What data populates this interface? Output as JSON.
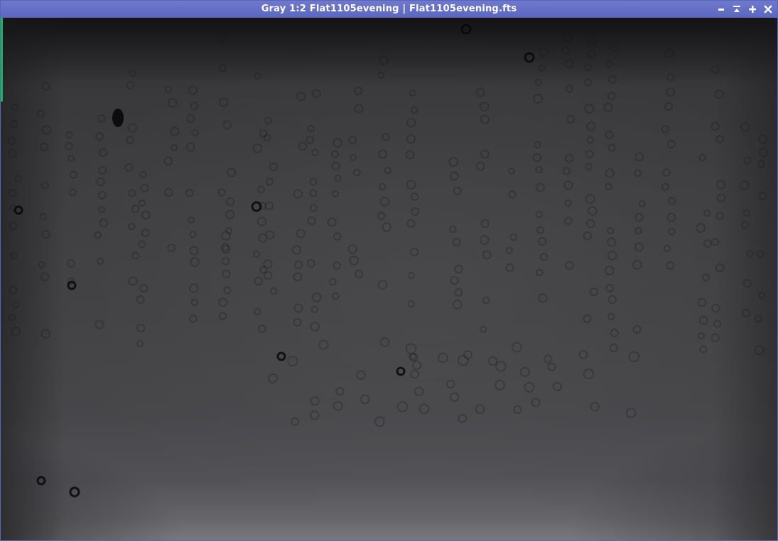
{
  "window": {
    "title": "Gray 1:2 Flat1105evening | Flat1105evening.fts"
  },
  "controls": [
    {
      "name": "minimize-button",
      "icon": "minimize-icon"
    },
    {
      "name": "shade-button",
      "icon": "shade-icon"
    },
    {
      "name": "maximize-button",
      "icon": "maximize-icon"
    },
    {
      "name": "close-button",
      "icon": "close-icon"
    }
  ],
  "image": {
    "kind": "flat-field frame",
    "colors": {
      "titlebar": "#5b66bf",
      "marker": "#19b45a"
    }
  }
}
